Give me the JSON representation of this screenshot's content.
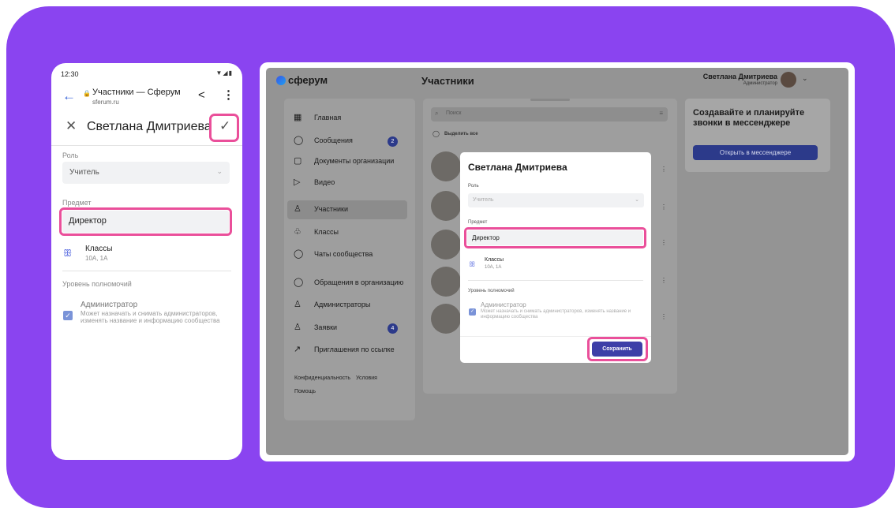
{
  "phone": {
    "time": "12:30",
    "status_icons": "▼◢▮",
    "page_title": "Участники — Сферум",
    "url": "sferum.ru",
    "user_name": "Светлана Дмитриева",
    "role_label": "Роль",
    "role_value": "Учитель",
    "subject_label": "Предмет",
    "subject_value": "Директор",
    "classes_label": "Классы",
    "classes_value": "10А, 1А",
    "permission_label": "Уровень полномочий",
    "admin_label": "Администратор",
    "admin_desc": "Может назначать и снимать администраторов, изменять название и информацию сообщества"
  },
  "desktop": {
    "logo": "сферум",
    "page_title": "Участники",
    "user_name": "Светлана Дмитриева",
    "user_role": "Администратор",
    "sidebar": [
      {
        "icon": "▦",
        "label": "Главная",
        "badge": ""
      },
      {
        "icon": "◯",
        "label": "Сообщения",
        "badge": "2"
      },
      {
        "icon": "▢",
        "label": "Документы организации",
        "badge": ""
      },
      {
        "icon": "▷",
        "label": "Видео",
        "badge": ""
      },
      {
        "icon": "♙",
        "label": "Участники",
        "badge": ""
      },
      {
        "icon": "♧",
        "label": "Классы",
        "badge": ""
      },
      {
        "icon": "◯",
        "label": "Чаты сообщества",
        "badge": ""
      },
      {
        "icon": "◯",
        "label": "Обращения в организацию",
        "badge": ""
      },
      {
        "icon": "♙",
        "label": "Администраторы",
        "badge": ""
      },
      {
        "icon": "♙",
        "label": "Заявки",
        "badge": "4"
      },
      {
        "icon": "↗",
        "label": "Приглашения по ссылке",
        "badge": ""
      }
    ],
    "footer": {
      "privacy": "Конфиденциальность",
      "terms": "Условия",
      "help": "Помощь"
    },
    "search_placeholder": "Поиск",
    "select_all": "Выделить все",
    "right_card": {
      "title": "Создавайте и планируйте звонки в мессенджере",
      "button": "Открыть в мессенджере"
    },
    "modal": {
      "title": "Светлана Дмитриева",
      "role_label": "Роль",
      "role_value": "Учитель",
      "subject_label": "Предмет",
      "subject_value": "Директор",
      "classes_label": "Классы",
      "classes_value": "10А, 1А",
      "permission_label": "Уровень полномочий",
      "admin_label": "Администратор",
      "admin_desc": "Может назначать и снимать администраторов, изменять название и информацию сообщества",
      "save_button": "Сохранить"
    }
  },
  "colors": {
    "background": "#8a44f0",
    "highlight": "#ea4f9a",
    "primary": "#3d3fa8"
  }
}
